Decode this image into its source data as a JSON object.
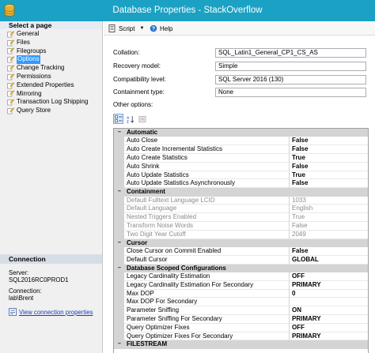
{
  "window": {
    "title": "Database Properties - StackOverflow"
  },
  "sidebar": {
    "header": "Select a page",
    "items": [
      {
        "label": "General",
        "icon": "wrench-icon",
        "selected": false
      },
      {
        "label": "Files",
        "icon": "wrench-icon",
        "selected": false
      },
      {
        "label": "Filegroups",
        "icon": "wrench-icon",
        "selected": false
      },
      {
        "label": "Options",
        "icon": "wrench-icon",
        "selected": true
      },
      {
        "label": "Change Tracking",
        "icon": "wrench-icon",
        "selected": false
      },
      {
        "label": "Permissions",
        "icon": "wrench-icon",
        "selected": false
      },
      {
        "label": "Extended Properties",
        "icon": "wrench-icon",
        "selected": false
      },
      {
        "label": "Mirroring",
        "icon": "wrench-icon",
        "selected": false
      },
      {
        "label": "Transaction Log Shipping",
        "icon": "wrench-icon",
        "selected": false
      },
      {
        "label": "Query Store",
        "icon": "wrench-icon",
        "selected": false
      }
    ]
  },
  "connection": {
    "header": "Connection",
    "server_label": "Server:",
    "server_value": "SQL2016RC0PROD1",
    "conn_label": "Connection:",
    "conn_value": "lab\\Brent",
    "link": "View connection properties"
  },
  "toolbar": {
    "script_label": "Script",
    "help_label": "Help"
  },
  "form": {
    "collation_label": "Collation:",
    "collation_value": "SQL_Latin1_General_CP1_CS_AS",
    "recovery_label": "Recovery model:",
    "recovery_value": "Simple",
    "compat_label": "Compatibility level:",
    "compat_value": "SQL Server 2016 (130)",
    "containment_label": "Containment type:",
    "containment_value": "None",
    "other_label": "Other options:"
  },
  "grid": {
    "categories": [
      {
        "name": "Automatic",
        "rows": [
          {
            "name": "Auto Close",
            "value": "False",
            "bold": true,
            "disabled": false
          },
          {
            "name": "Auto Create Incremental Statistics",
            "value": "False",
            "bold": true,
            "disabled": false
          },
          {
            "name": "Auto Create Statistics",
            "value": "True",
            "bold": true,
            "disabled": false
          },
          {
            "name": "Auto Shrink",
            "value": "False",
            "bold": true,
            "disabled": false
          },
          {
            "name": "Auto Update Statistics",
            "value": "True",
            "bold": true,
            "disabled": false
          },
          {
            "name": "Auto Update Statistics Asynchronously",
            "value": "False",
            "bold": true,
            "disabled": false
          }
        ]
      },
      {
        "name": "Containment",
        "rows": [
          {
            "name": "Default Fulltext Language LCID",
            "value": "1033",
            "bold": false,
            "disabled": true
          },
          {
            "name": "Default Language",
            "value": "English",
            "bold": false,
            "disabled": true
          },
          {
            "name": "Nested Triggers Enabled",
            "value": "True",
            "bold": false,
            "disabled": true
          },
          {
            "name": "Transform Noise Words",
            "value": "False",
            "bold": false,
            "disabled": true
          },
          {
            "name": "Two Digit Year Cutoff",
            "value": "2049",
            "bold": false,
            "disabled": true
          }
        ]
      },
      {
        "name": "Cursor",
        "rows": [
          {
            "name": "Close Cursor on Commit Enabled",
            "value": "False",
            "bold": true,
            "disabled": false
          },
          {
            "name": "Default Cursor",
            "value": "GLOBAL",
            "bold": true,
            "disabled": false
          }
        ]
      },
      {
        "name": "Database Scoped Configurations",
        "rows": [
          {
            "name": "Legacy Cardinality Estimation",
            "value": "OFF",
            "bold": true,
            "disabled": false
          },
          {
            "name": "Legacy Cardinality Estimation For Secondary",
            "value": "PRIMARY",
            "bold": true,
            "disabled": false
          },
          {
            "name": "Max DOP",
            "value": "0",
            "bold": true,
            "disabled": false
          },
          {
            "name": "Max DOP For Secondary",
            "value": "",
            "bold": true,
            "disabled": false
          },
          {
            "name": "Parameter Sniffing",
            "value": "ON",
            "bold": true,
            "disabled": false
          },
          {
            "name": "Parameter Sniffing For Secondary",
            "value": "PRIMARY",
            "bold": true,
            "disabled": false
          },
          {
            "name": "Query Optimizer Fixes",
            "value": "OFF",
            "bold": true,
            "disabled": false
          },
          {
            "name": "Query Optimizer Fixes For Secondary",
            "value": "PRIMARY",
            "bold": true,
            "disabled": false
          }
        ]
      },
      {
        "name": "FILESTREAM",
        "rows": []
      }
    ]
  }
}
